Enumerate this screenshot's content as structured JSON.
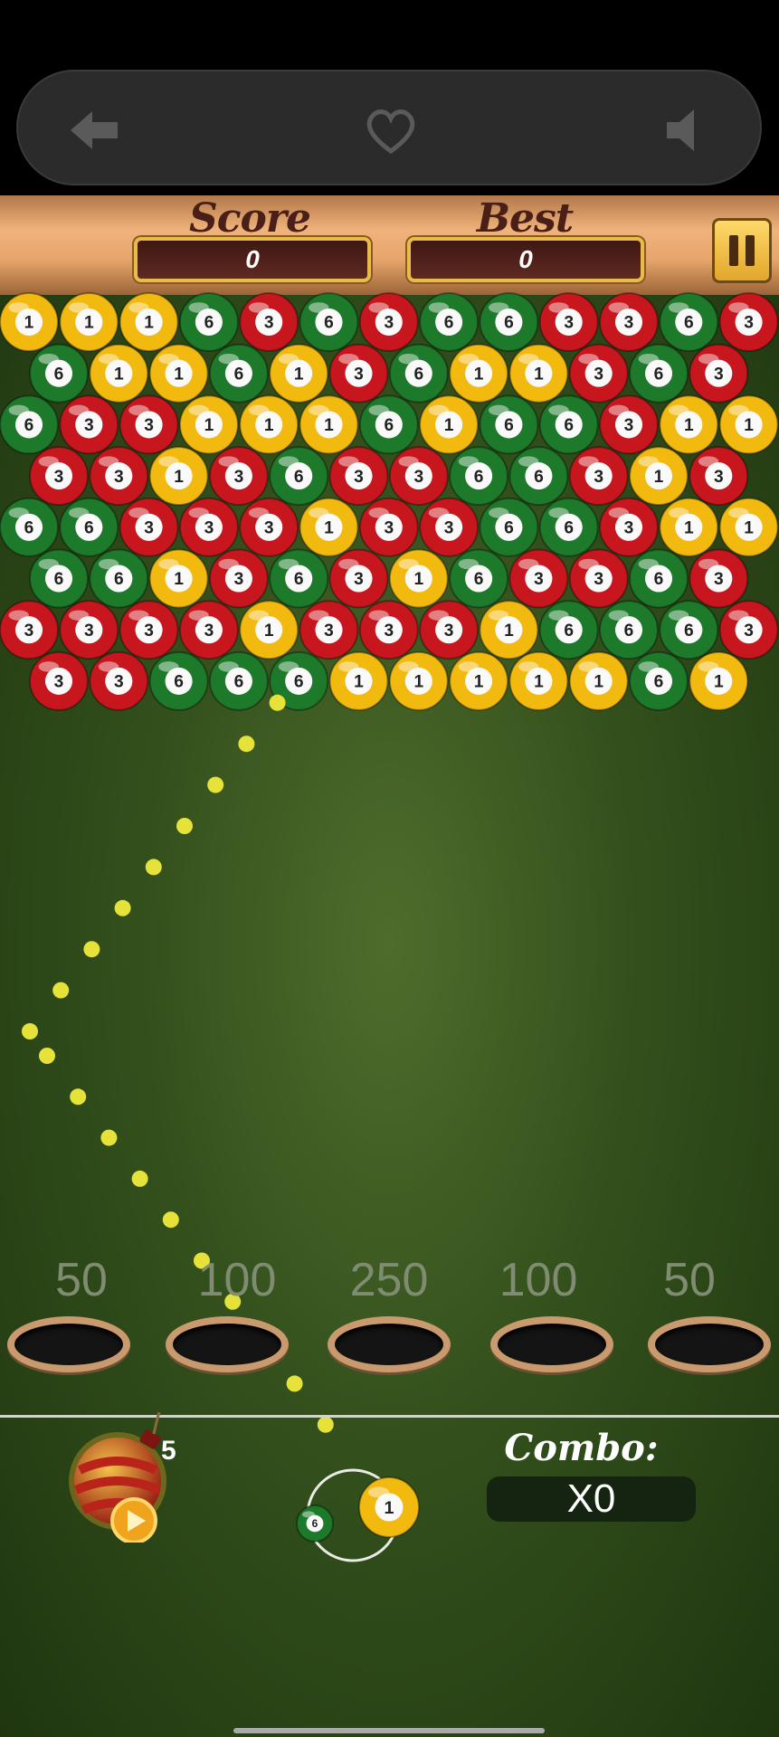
{
  "hud": {
    "score_label": "Score",
    "score_value": "0",
    "best_label": "Best",
    "best_value": "0"
  },
  "topbar": {
    "back_icon": "back-arrow-icon",
    "heart_icon": "heart-icon",
    "sound_icon": "speaker-icon"
  },
  "colors": {
    "red": "#c8161e",
    "green": "#1d7a2a",
    "yellow": "#f2b90f"
  },
  "bubble_rows": [
    [
      "1",
      "1",
      "1",
      "6",
      "3",
      "6",
      "3",
      "6",
      "6",
      "3",
      "3",
      "6",
      "3"
    ],
    [
      "6",
      "1",
      "1",
      "6",
      "1",
      "3",
      "6",
      "1",
      "1",
      "3",
      "6",
      "3"
    ],
    [
      "6",
      "3",
      "3",
      "1",
      "1",
      "1",
      "6",
      "1",
      "6",
      "6",
      "3",
      "1",
      "1"
    ],
    [
      "3",
      "3",
      "1",
      "3",
      "6",
      "3",
      "3",
      "6",
      "6",
      "3",
      "1",
      "3"
    ],
    [
      "6",
      "6",
      "3",
      "3",
      "3",
      "1",
      "3",
      "3",
      "6",
      "6",
      "3",
      "1",
      "1"
    ],
    [
      "6",
      "6",
      "1",
      "3",
      "6",
      "3",
      "1",
      "6",
      "3",
      "3",
      "6",
      "3"
    ],
    [
      "3",
      "3",
      "3",
      "3",
      "1",
      "3",
      "3",
      "3",
      "1",
      "6",
      "6",
      "6",
      "3"
    ],
    [
      "3",
      "3",
      "6",
      "6",
      "6",
      "1",
      "1",
      "1",
      "1",
      "1",
      "6",
      "1"
    ]
  ],
  "pockets": [
    "50",
    "100",
    "250",
    "100",
    "50"
  ],
  "bomb": {
    "count": "5",
    "icon": "bomb-icon",
    "play_icon": "play-icon"
  },
  "shooter": {
    "current": "1",
    "next": "6"
  },
  "combo": {
    "label": "Combo:",
    "value": "X0"
  }
}
